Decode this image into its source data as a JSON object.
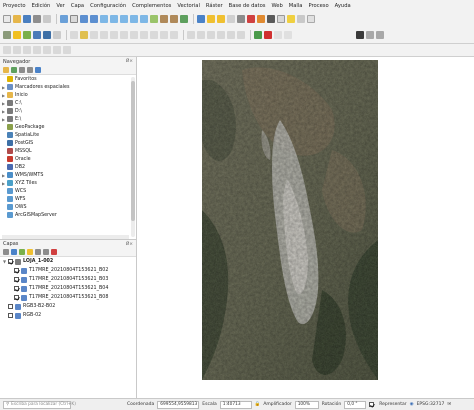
{
  "menu": [
    "Proyecto",
    "Edición",
    "Ver",
    "Capa",
    "Configuración",
    "Complementos",
    "Vectorial",
    "Ráster",
    "Base de datos",
    "Web",
    "Malla",
    "Proceso",
    "Ayuda"
  ],
  "browser_panel": {
    "title": "Navegador",
    "close": "Ø×",
    "items": [
      {
        "label": "Favoritos",
        "icon": "star-icon",
        "color": "#e0b400",
        "arrow": ""
      },
      {
        "label": "Marcadores espaciales",
        "icon": "bookmark-icon",
        "color": "#6a8fc4",
        "arrow": "▶"
      },
      {
        "label": "Inicio",
        "icon": "folder-icon",
        "color": "#e6b64a",
        "arrow": "▶"
      },
      {
        "label": "C:\\",
        "icon": "drive-icon",
        "color": "#7a7a7a",
        "arrow": "▶"
      },
      {
        "label": "D:\\",
        "icon": "drive-icon",
        "color": "#7a7a7a",
        "arrow": "▶"
      },
      {
        "label": "E:\\",
        "icon": "drive-icon",
        "color": "#7a7a7a",
        "arrow": "▶"
      },
      {
        "label": "GeoPackage",
        "icon": "geopackage-icon",
        "color": "#8aa04a",
        "arrow": ""
      },
      {
        "label": "SpatiaLite",
        "icon": "spatialite-icon",
        "color": "#4a82b8",
        "arrow": ""
      },
      {
        "label": "PostGIS",
        "icon": "postgis-icon",
        "color": "#3d6fa6",
        "arrow": ""
      },
      {
        "label": "MSSQL",
        "icon": "mssql-icon",
        "color": "#b04a4a",
        "arrow": ""
      },
      {
        "label": "Oracle",
        "icon": "oracle-icon",
        "color": "#c83a2e",
        "arrow": ""
      },
      {
        "label": "DB2",
        "icon": "db2-icon",
        "color": "#4a6ab0",
        "arrow": ""
      },
      {
        "label": "WMS/WMTS",
        "icon": "wms-icon",
        "color": "#4a8ec8",
        "arrow": "▶"
      },
      {
        "label": "XYZ Tiles",
        "icon": "xyz-tiles-icon",
        "color": "#4aa0c8",
        "arrow": "▶"
      },
      {
        "label": "WCS",
        "icon": "wcs-icon",
        "color": "#5a9ad0",
        "arrow": ""
      },
      {
        "label": "WFS",
        "icon": "wfs-icon",
        "color": "#5a9ad0",
        "arrow": ""
      },
      {
        "label": "OWS",
        "icon": "ows-icon",
        "color": "#5a9ad0",
        "arrow": ""
      },
      {
        "label": "ArcGISMapServer",
        "icon": "arcgis-icon",
        "color": "#5a9ad0",
        "arrow": ""
      }
    ]
  },
  "layers_panel": {
    "title": "Capas",
    "close": "Ø×",
    "items": [
      {
        "label": "LOJA_1-002",
        "checked": true,
        "bold": true,
        "icon": "group-icon",
        "color": "#7c7c7c",
        "indent": 0
      },
      {
        "label": "T17MRE_20210804T153621_B02",
        "checked": true,
        "bold": false,
        "icon": "raster-layer-icon",
        "color": "#5a86c8",
        "indent": 1
      },
      {
        "label": "T17MRE_20210804T153621_B03",
        "checked": true,
        "bold": false,
        "icon": "raster-layer-icon",
        "color": "#5a86c8",
        "indent": 1
      },
      {
        "label": "T17MRE_20210804T153621_B04",
        "checked": true,
        "bold": false,
        "icon": "raster-layer-icon",
        "color": "#5a86c8",
        "indent": 1
      },
      {
        "label": "T17MRE_20210804T153621_B08",
        "checked": true,
        "bold": false,
        "icon": "raster-layer-icon",
        "color": "#5a86c8",
        "indent": 1
      },
      {
        "label": "RGB3-B2-B02",
        "checked": false,
        "bold": false,
        "icon": "raster-layer-icon",
        "color": "#5a86c8",
        "indent": 0
      },
      {
        "label": "RGB-02",
        "checked": false,
        "bold": false,
        "icon": "raster-layer-icon",
        "color": "#5a86c8",
        "indent": 0
      }
    ]
  },
  "status": {
    "locator_placeholder": "Escriba para localizar (Ctrl+K)",
    "coordinate_label": "Coordenada",
    "coordinate_value": "699554,9559813",
    "scale_label": "Escala",
    "scale_value": "1:40713",
    "magnifier_label": "Amplificador",
    "magnifier_value": "100%",
    "rotation_label": "Rotación",
    "rotation_value": "0,0 °",
    "render_label": "Representar",
    "crs_label": "EPSG:32717"
  },
  "colors": {
    "toolbar_bg": "#f2f2f2",
    "canvas_bg": "#ffffff",
    "accent": "#3b6fb6"
  }
}
